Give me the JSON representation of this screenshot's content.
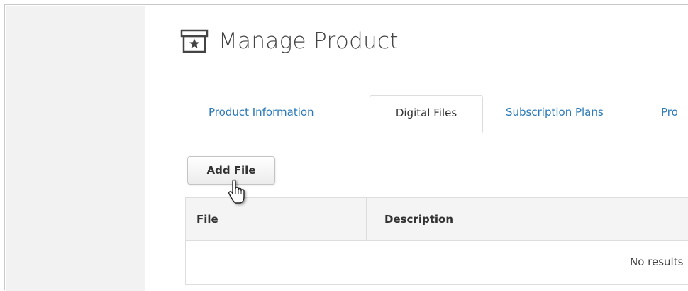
{
  "page": {
    "title": "Manage Product",
    "title_icon": "archive-box-star-icon"
  },
  "tabs": [
    {
      "label": "Product Information",
      "active": false
    },
    {
      "label": "Digital Files",
      "active": true
    },
    {
      "label": "Subscription Plans",
      "active": false
    },
    {
      "label": "Pro",
      "active": false
    }
  ],
  "toolbar": {
    "add_file_label": "Add File"
  },
  "table": {
    "columns": [
      "File",
      "Description"
    ],
    "empty_message": "No results"
  },
  "colors": {
    "link": "#2a7ab8",
    "sidebar": "#f2f2f2",
    "header_bg": "#f4f4f4"
  },
  "cursor": "pointer-hand-icon"
}
